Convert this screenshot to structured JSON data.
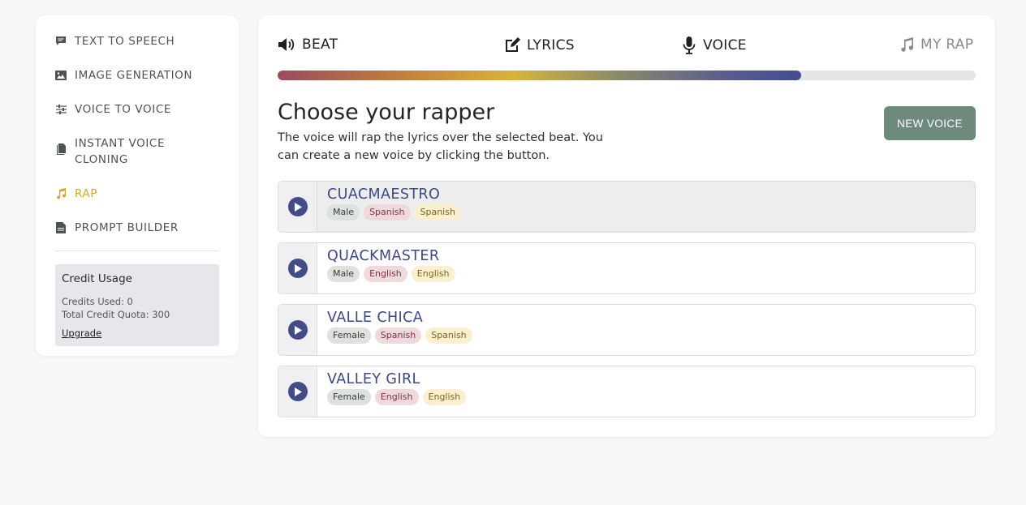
{
  "sidebar": {
    "items": [
      {
        "label": "TEXT TO SPEECH",
        "icon": "chat-icon"
      },
      {
        "label": "IMAGE GENERATION",
        "icon": "image-icon"
      },
      {
        "label": "VOICE TO VOICE",
        "icon": "sliders-icon"
      },
      {
        "label": "INSTANT VOICE CLONING",
        "icon": "documents-icon"
      },
      {
        "label": "RAP",
        "icon": "music-note-icon",
        "active": true
      },
      {
        "label": "PROMPT BUILDER",
        "icon": "document-icon"
      }
    ],
    "credit": {
      "title": "Credit Usage",
      "used": "Credits Used: 0",
      "quota": "Total Credit Quota: 300",
      "upgrade": "Upgrade"
    }
  },
  "steps": [
    {
      "label": "BEAT",
      "icon": "speaker-icon"
    },
    {
      "label": "LYRICS",
      "icon": "edit-icon"
    },
    {
      "label": "VOICE",
      "icon": "microphone-icon"
    },
    {
      "label": "MY RAP",
      "icon": "music-note-icon"
    }
  ],
  "progress": 0.75,
  "main": {
    "title": "Choose your rapper",
    "description": "The voice will rap the lyrics over the selected beat. You can create a new voice by clicking the button.",
    "new_voice_label": "NEW VOICE"
  },
  "voices": [
    {
      "name": "CUACMAESTRO",
      "gender": "Male",
      "language": "Spanish",
      "accent": "Spanish",
      "selected": true
    },
    {
      "name": "QUACKMASTER",
      "gender": "Male",
      "language": "English",
      "accent": "English"
    },
    {
      "name": "VALLE CHICA",
      "gender": "Female",
      "language": "Spanish",
      "accent": "Spanish"
    },
    {
      "name": "VALLEY GIRL",
      "gender": "Female",
      "language": "English",
      "accent": "English"
    }
  ],
  "colors": {
    "accent_active": "#d1a929",
    "button": "#6e8a7c",
    "voice_name": "#3d4782",
    "play_button": "#434c86"
  }
}
